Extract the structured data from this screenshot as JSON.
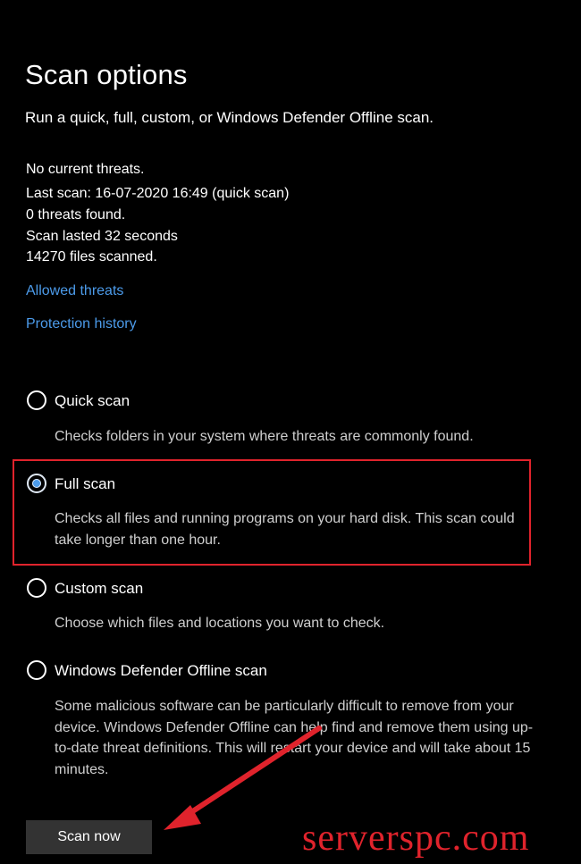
{
  "header": {
    "title": "Scan options",
    "subtitle": "Run a quick, full, custom, or Windows Defender Offline scan."
  },
  "status": {
    "threats": "No current threats.",
    "last_scan": "Last scan: 16-07-2020 16:49 (quick scan)",
    "found": "0 threats found.",
    "duration": "Scan lasted 32 seconds",
    "files": "14270 files scanned."
  },
  "links": {
    "allowed_threats": "Allowed threats",
    "protection_history": "Protection history"
  },
  "options": [
    {
      "label": "Quick scan",
      "description": "Checks folders in your system where threats are commonly found.",
      "selected": false
    },
    {
      "label": "Full scan",
      "description": "Checks all files and running programs on your hard disk. This scan could take longer than one hour.",
      "selected": true
    },
    {
      "label": "Custom scan",
      "description": "Choose which files and locations you want to check.",
      "selected": false
    },
    {
      "label": "Windows Defender Offline scan",
      "description": "Some malicious software can be particularly difficult to remove from your device. Windows Defender Offline can help find and remove them using up-to-date threat definitions. This will restart your device and will take about 15 minutes.",
      "selected": false
    }
  ],
  "actions": {
    "scan_now": "Scan now"
  },
  "watermark": {
    "text": "serverspc.com"
  },
  "colors": {
    "background": "#000000",
    "text": "#ffffff",
    "link": "#4c9bea",
    "annotation": "#e0232c",
    "button": "#333333"
  }
}
